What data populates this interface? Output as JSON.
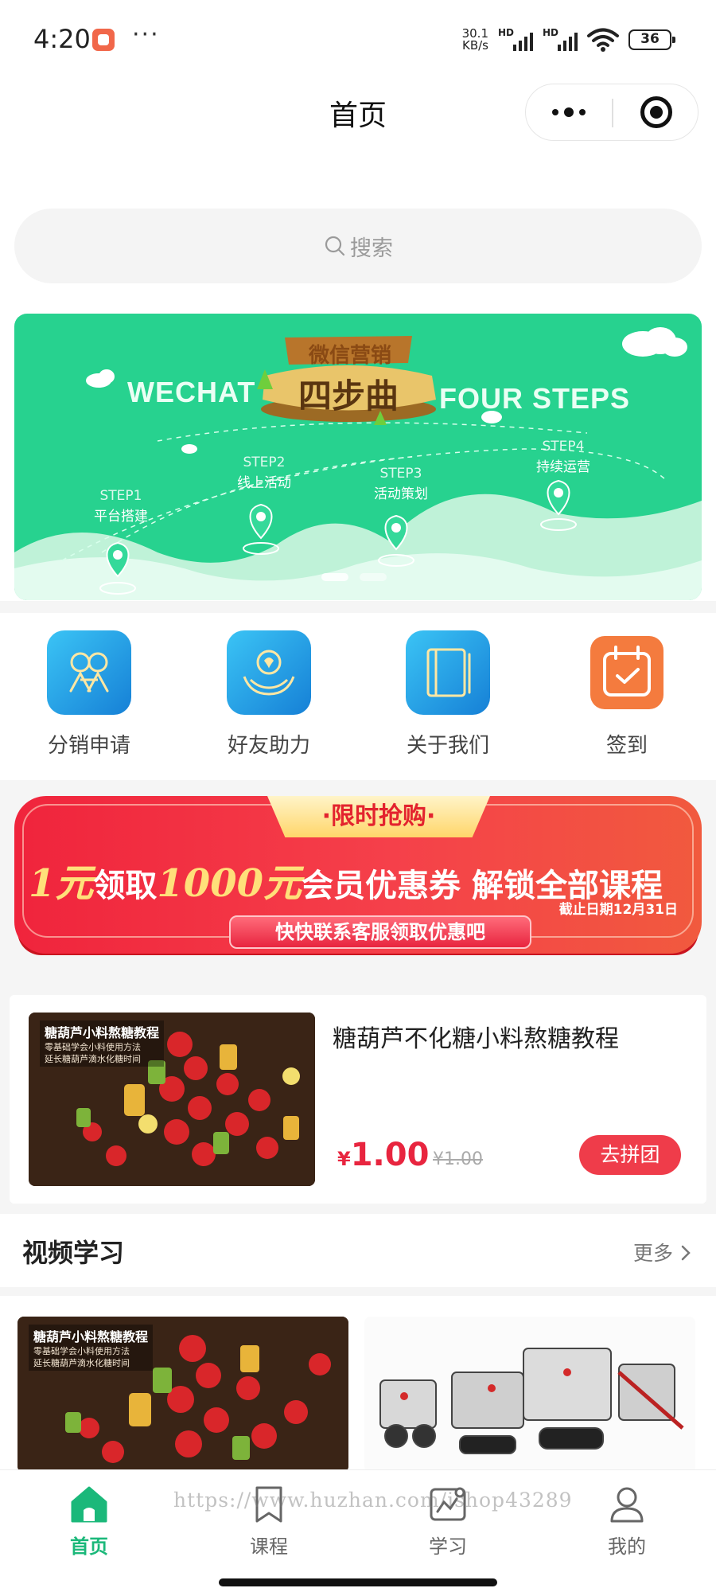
{
  "status_bar": {
    "time": "4:20",
    "more": "···",
    "speed_top": "30.1",
    "speed_bottom": "KB/s",
    "hd1": "HD",
    "hd2": "HD",
    "battery": "36"
  },
  "nav": {
    "title": "首页"
  },
  "search": {
    "placeholder": "搜索"
  },
  "banner": {
    "badge_top": "微信营销",
    "badge_main": "四步曲",
    "left_text": "WECHAT",
    "right_text": "FOUR STEPS",
    "steps": [
      {
        "en": "STEP1",
        "cn": "平台搭建"
      },
      {
        "en": "STEP2",
        "cn": "线上活动"
      },
      {
        "en": "STEP3",
        "cn": "活动策划"
      },
      {
        "en": "STEP4",
        "cn": "持续运营"
      }
    ],
    "slide_count": 2,
    "active_slide": 1
  },
  "quick_entries": [
    {
      "label": "分销申请",
      "icon": "distribution-icon",
      "color": "#1e9fe6"
    },
    {
      "label": "好友助力",
      "icon": "friends-help-icon",
      "color": "#1e9fe6"
    },
    {
      "label": "关于我们",
      "icon": "about-book-icon",
      "color": "#1e9fe6"
    },
    {
      "label": "签到",
      "icon": "calendar-check-icon",
      "color": "#f47b3e"
    }
  ],
  "promo": {
    "tag": "·限时抢购·",
    "part1": "1元",
    "part2": "领取",
    "part3": "1000元",
    "part4": "会员优惠券",
    "part5": "解锁全部课程",
    "deadline": "截止日期12月31日",
    "cta": "快快联系客服领取优惠吧"
  },
  "group_product": {
    "image_title": "糖葫芦小料熬糖教程",
    "image_sub1": "零基础学会小料使用方法",
    "image_sub2": "延长糖葫芦滴水化糖时间",
    "title": "糖葫芦不化糖小料熬糖教程",
    "currency": "¥",
    "price": "1.00",
    "original_price": "¥1.00",
    "button": "去拼团"
  },
  "video_section": {
    "title": "视频学习",
    "more": "更多",
    "card1": {
      "image_title": "糖葫芦小料熬糖教程",
      "image_sub1": "零基础学会小料使用方法",
      "image_sub2": "延长糖葫芦滴水化糖时间"
    }
  },
  "tabbar": {
    "items": [
      {
        "label": "首页",
        "icon": "home-icon",
        "active": true
      },
      {
        "label": "课程",
        "icon": "course-bookmark-icon",
        "active": false
      },
      {
        "label": "学习",
        "icon": "study-icon",
        "active": false
      },
      {
        "label": "我的",
        "icon": "profile-icon",
        "active": false
      }
    ],
    "accent": "#1bb87a"
  },
  "watermark": "https://www.huzhan.com/ishop43289"
}
